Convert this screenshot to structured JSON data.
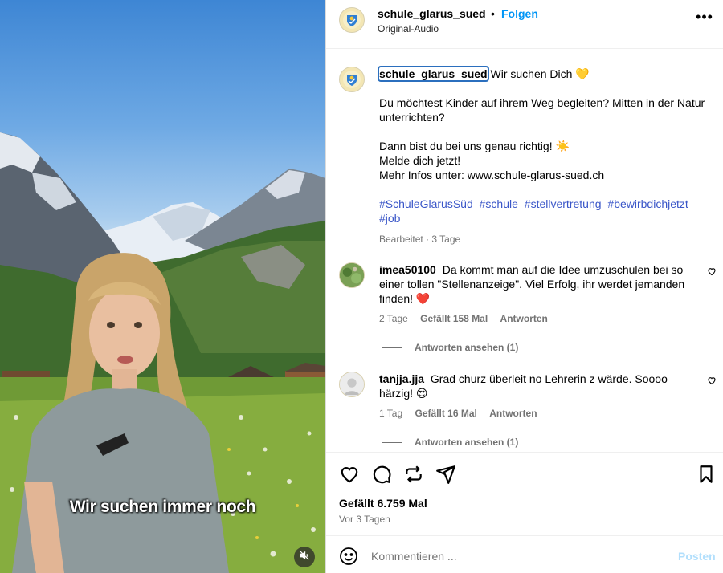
{
  "video": {
    "subtitle": "Wir suchen immer noch",
    "mute_icon": "speaker-muted-icon"
  },
  "post": {
    "username": "schule_glarus_sued",
    "separator": "•",
    "follow_label": "Folgen",
    "audio_label": "Original-Audio",
    "more_icon": "more-horizontal-icon",
    "more_label": "•••"
  },
  "caption": {
    "username": "schule_glarus_sued",
    "headline": "Wir suchen Dich 💛",
    "para1": "Du möchtest Kinder auf ihrem Weg begleiten? Mitten in der Natur unterrichten?",
    "para2_line1": "Dann bist du bei uns genau richtig! ☀️",
    "para2_line2": "Melde dich jetzt!",
    "para2_line3": "Mehr Infos unter: www.schule-glarus-sued.ch",
    "hashtags": [
      "#SchuleGlarusSüd",
      "#schule",
      "#stellvertretung",
      "#bewirbdichjetzt",
      "#job"
    ],
    "meta": "Bearbeitet · 3 Tage"
  },
  "comments": [
    {
      "username": "imea50100",
      "text": "Da kommt man auf die Idee umzuschulen bei so einer tollen \"Stellenanzeige\". Viel Erfolg, ihr werdet jemanden finden! ❤️",
      "time": "2 Tage",
      "likes": "Gefällt 158 Mal",
      "reply": "Antworten",
      "view_replies": "Antworten ansehen (1)"
    },
    {
      "username": "tanjja.jja",
      "text": "Grad churz überleit no Lehrerin z wärde. Soooo härzig! 😍",
      "time": "1 Tag",
      "likes": "Gefällt 16 Mal",
      "reply": "Antworten",
      "view_replies": "Antworten ansehen (1)"
    }
  ],
  "actions": {
    "icons": [
      "heart-icon",
      "comment-icon",
      "share-icon",
      "send-icon",
      "bookmark-icon"
    ],
    "likes": "Gefällt 6.759 Mal",
    "posted_ago": "Vor 3 Tagen"
  },
  "composer": {
    "emoji_icon": "emoji-icon",
    "placeholder": "Kommentieren ...",
    "post_label": "Posten"
  }
}
